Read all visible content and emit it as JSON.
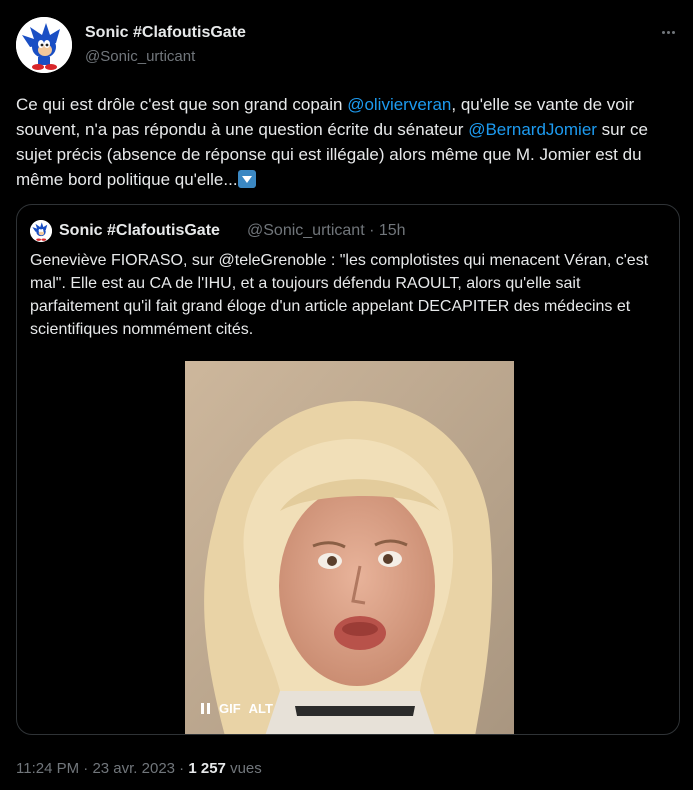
{
  "author": {
    "display_name": "Sonic #ClafoutisGate",
    "handle": "@Sonic_urticant",
    "avatar_icon": "sonic-avatar-icon"
  },
  "tweet": {
    "text_1": "Ce qui est drôle c'est que son grand copain ",
    "mention_1": "@olivierveran",
    "text_2": ", qu'elle se vante de voir souvent, n'a pas répondu à une question écrite du sénateur ",
    "mention_2": "@BernardJomier",
    "text_3": " sur ce sujet précis (absence de réponse qui est illégale) alors même que M. Jomier est du même bord politique qu'elle...",
    "emoji": "down-arrow-emoji"
  },
  "quote": {
    "display_name": "Sonic #ClafoutisGate",
    "handle": "@Sonic_urticant",
    "time": "15h",
    "separator": " · ",
    "text": "Geneviève FIORASO, sur @teleGrenoble : \"les complotistes qui menacent Véran, c'est mal\". Elle est au CA de l'IHU, et a toujours défendu RAOULT, alors qu'elle sait parfaitement qu'il fait grand éloge d'un article appelant DECAPITER des médecins et scientifiques nommément cités.",
    "media_badges": {
      "gif": "GIF",
      "alt": "ALT"
    }
  },
  "footer": {
    "time": "11:24 PM",
    "sep1": " · ",
    "date": "23 avr. 2023",
    "sep2": " · ",
    "views_count": "1 257",
    "views_label": " vues"
  },
  "colors": {
    "background": "#000000",
    "text": "#e7e9ea",
    "muted": "#71767b",
    "link": "#1d9bf0",
    "border": "#2f3336"
  }
}
